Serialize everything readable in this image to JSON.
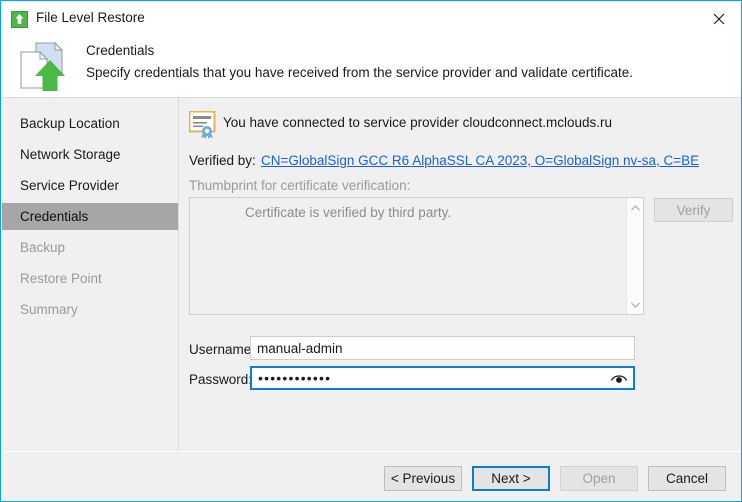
{
  "window": {
    "title": "File Level Restore",
    "title_icon": "restore-arrow-icon",
    "close_icon": "close-icon"
  },
  "header": {
    "icon": "file-restore-documents-icon",
    "title": "Credentials",
    "subtitle": "Specify credentials that you have received from the service provider and validate certificate."
  },
  "sidebar": {
    "items": [
      {
        "label": "Backup Location",
        "state": "done"
      },
      {
        "label": "Network Storage",
        "state": "done"
      },
      {
        "label": "Service Provider",
        "state": "done"
      },
      {
        "label": "Credentials",
        "state": "selected"
      },
      {
        "label": "Backup",
        "state": "disabled"
      },
      {
        "label": "Restore Point",
        "state": "disabled"
      },
      {
        "label": "Summary",
        "state": "disabled"
      }
    ]
  },
  "content": {
    "certificate_icon": "certificate-ribbon-icon",
    "connected_text": "You have connected to service provider cloudconnect.mclouds.ru",
    "verified_by_label": "Verified by:",
    "verified_by_link": "CN=GlobalSign GCC R6 AlphaSSL CA 2023, O=GlobalSign nv-sa, C=BE",
    "thumbprint_label": "Thumbprint for certificate verification:",
    "thumbprint_text": "Certificate is verified by third party.",
    "scroll_up_icon": "chevron-up-icon",
    "scroll_down_icon": "chevron-down-icon",
    "verify_button": "Verify",
    "username_label": "Username:",
    "username_value": "manual-admin",
    "username_placeholder": "",
    "password_label": "Password:",
    "password_value": "••••••••••••",
    "password_placeholder": "",
    "reveal_password_icon": "eye-icon"
  },
  "footer": {
    "previous": "< Previous",
    "next": "Next >",
    "open": "Open",
    "cancel": "Cancel"
  },
  "colors": {
    "accent": "#0a7ed4",
    "window_border": "#0aa3e8",
    "selection": "#a6a6a6",
    "link": "#1962d8",
    "green": "#4cb847",
    "cert_gold": "#e0b653",
    "cert_blue": "#6aaed9",
    "disabled_text": "#9a9a9a"
  }
}
